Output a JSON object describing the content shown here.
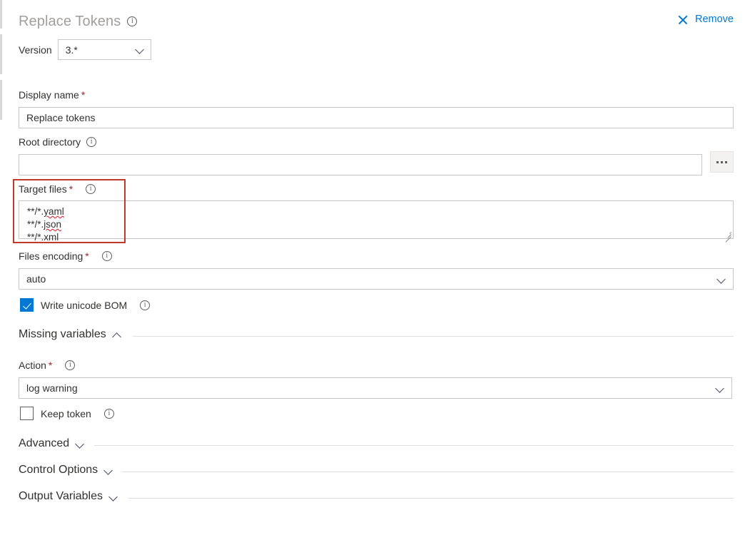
{
  "header": {
    "task_title": "Replace Tokens",
    "info_icon": "info-icon",
    "remove_label": "Remove",
    "remove_icon": "close-x-icon"
  },
  "version": {
    "label": "Version",
    "value": "3.*",
    "chevron_icon": "chevron-down-icon"
  },
  "fields": {
    "display_name": {
      "label": "Display name",
      "required": "*",
      "value": "Replace tokens"
    },
    "root_directory": {
      "label": "Root directory",
      "info_icon": "info-icon",
      "value": "",
      "browse_label": "...",
      "browse_icon": "ellipsis-icon"
    },
    "target_files": {
      "label": "Target files",
      "required": "*",
      "info_icon": "info-icon",
      "value": "**/*.yaml\n**/*.json\n**/*.xml",
      "lines": [
        {
          "prefix": "**/*.",
          "ext": "yaml",
          "misspelled": true
        },
        {
          "prefix": "**/*.",
          "ext": "json",
          "misspelled": true
        },
        {
          "prefix": "**/*.",
          "ext": "xml",
          "misspelled": false
        }
      ],
      "highlighted": true,
      "highlight_color": "#c0392b",
      "resize_handle_icon": "resize-grip-icon"
    },
    "files_encoding": {
      "label": "Files encoding",
      "required": "*",
      "info_icon": "info-icon",
      "value": "auto",
      "chevron_icon": "chevron-down-icon"
    },
    "write_bom": {
      "label": "Write unicode BOM",
      "info_icon": "info-icon",
      "checked": true,
      "accent_color": "#0078d4"
    },
    "action": {
      "label": "Action",
      "required": "*",
      "info_icon": "info-icon",
      "value": "log warning",
      "chevron_icon": "chevron-down-icon"
    },
    "keep_token": {
      "label": "Keep token",
      "info_icon": "info-icon",
      "checked": false
    }
  },
  "sections": [
    {
      "title": "Missing variables",
      "expanded": true,
      "chevron_icon": "chevron-up-icon"
    },
    {
      "title": "Advanced",
      "expanded": false,
      "chevron_icon": "chevron-down-icon"
    },
    {
      "title": "Control Options",
      "expanded": false,
      "chevron_icon": "chevron-down-icon"
    },
    {
      "title": "Output Variables",
      "expanded": false,
      "chevron_icon": "chevron-down-icon"
    }
  ],
  "colors": {
    "accent": "#0078d4",
    "required_marker": "#a4262c",
    "title_gray": "#a19f9d",
    "border": "#c8c6c4",
    "divider": "#e1dfdd",
    "highlight": "#c0392b",
    "spellcheck": "#e81123"
  }
}
